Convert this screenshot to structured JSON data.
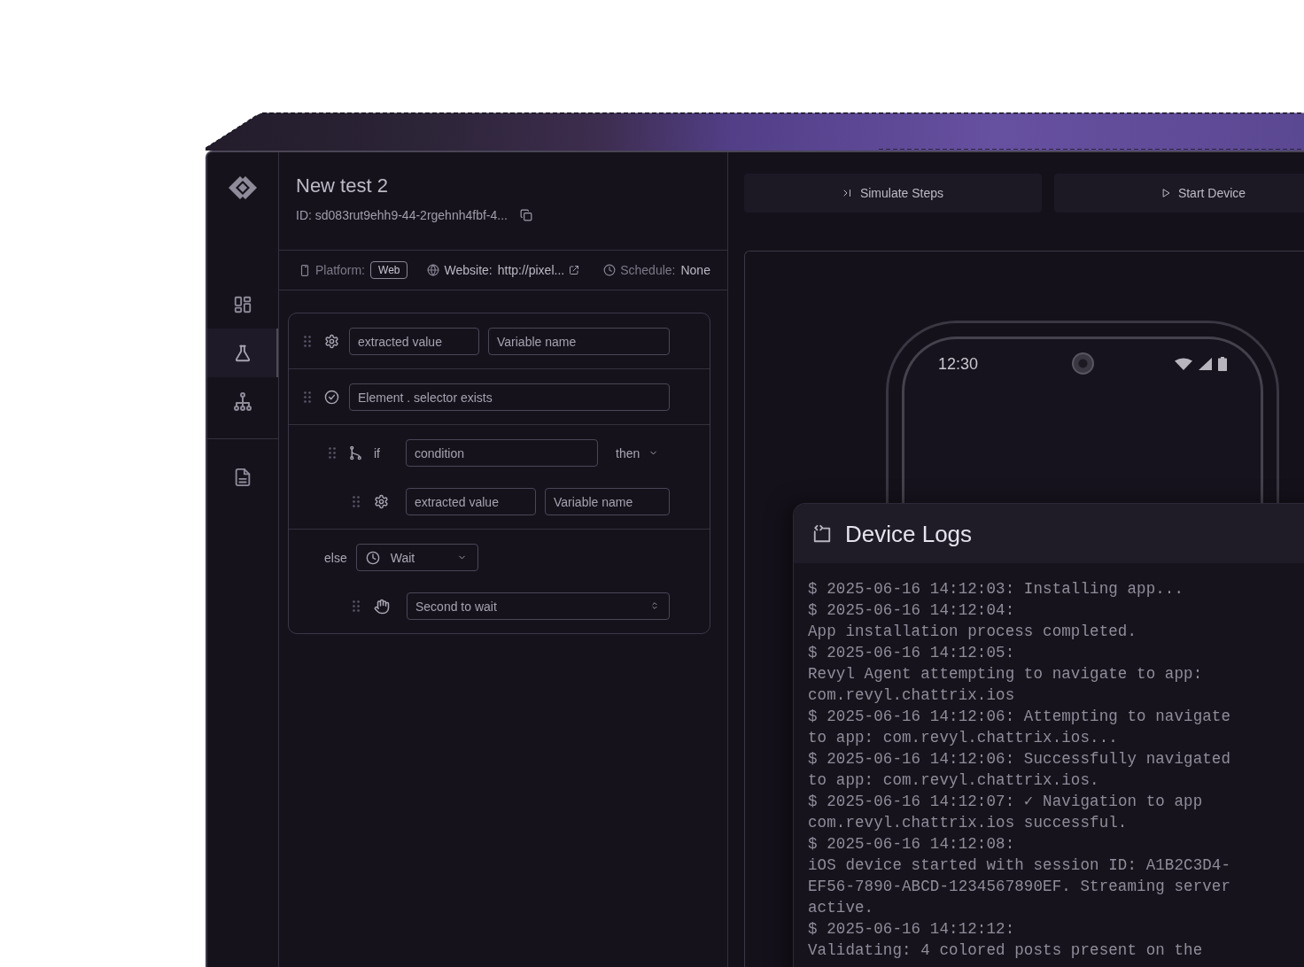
{
  "sidebar": {
    "items": [
      {
        "kind": "grid",
        "selected": false
      },
      {
        "kind": "flask",
        "selected": true
      },
      {
        "kind": "tree",
        "selected": false
      }
    ],
    "footer_items": [
      {
        "kind": "document",
        "selected": false
      }
    ]
  },
  "test": {
    "title": "New test 2",
    "id": "ID: sd083rut9ehh9-44-2rgehnh4fbf-4..."
  },
  "meta": [
    {
      "kind": "platform",
      "label": "Platform:",
      "badge": "Web"
    },
    {
      "kind": "website",
      "label": "Website:",
      "value": "http://pixel..."
    },
    {
      "kind": "schedule",
      "label": "Schedule:",
      "value": "None"
    }
  ],
  "steps": [
    {
      "kind": "extract",
      "fields": [
        {
          "placeholder": "extracted value"
        },
        {
          "placeholder": "Variable name"
        }
      ]
    },
    {
      "kind": "assert",
      "fields": [
        {
          "placeholder": "Element . selector exists"
        }
      ]
    },
    {
      "kind": "if",
      "keyword": "if",
      "fields": [
        {
          "placeholder": "condition"
        }
      ],
      "branch": "then",
      "children": [
        {
          "kind": "extract",
          "fields": [
            {
              "placeholder": "extracted value"
            },
            {
              "placeholder": "Variable name"
            }
          ]
        }
      ]
    },
    {
      "kind": "else",
      "keyword": "else",
      "action": "Wait",
      "children": [
        {
          "kind": "wait",
          "fields": [
            {
              "placeholder": "Second to wait"
            }
          ]
        }
      ]
    }
  ],
  "actions": [
    {
      "kind": "simulate",
      "label": "Simulate Steps"
    },
    {
      "kind": "start",
      "label": "Start Device"
    }
  ],
  "device": {
    "time": "12:30"
  },
  "logs": {
    "title": "Device Logs",
    "lines": [
      "$ 2025-06-16 14:12:03: Installing app...",
      "$ 2025-06-16 14:12:04:",
      "App installation process completed.",
      "$ 2025-06-16 14:12:05:",
      "Revyl Agent attempting to navigate to app:",
      "com.revyl.chattrix.ios",
      "$ 2025-06-16 14:12:06: Attempting to navigate",
      "to app: com.revyl.chattrix.ios...",
      "$ 2025-06-16 14:12:06: Successfully navigated",
      "to app: com.revyl.chattrix.ios.",
      "$ 2025-06-16 14:12:07: ✓ Navigation to app",
      "com.revyl.chattrix.ios successful.",
      "$ 2025-06-16 14:12:08:",
      "iOS device started with session ID: A1B2C3D4-",
      "EF56-7890-ABCD-1234567890EF. Streaming server",
      "active.",
      "$ 2025-06-16 14:12:12:",
      "Validating: 4 colored posts present on the"
    ]
  }
}
